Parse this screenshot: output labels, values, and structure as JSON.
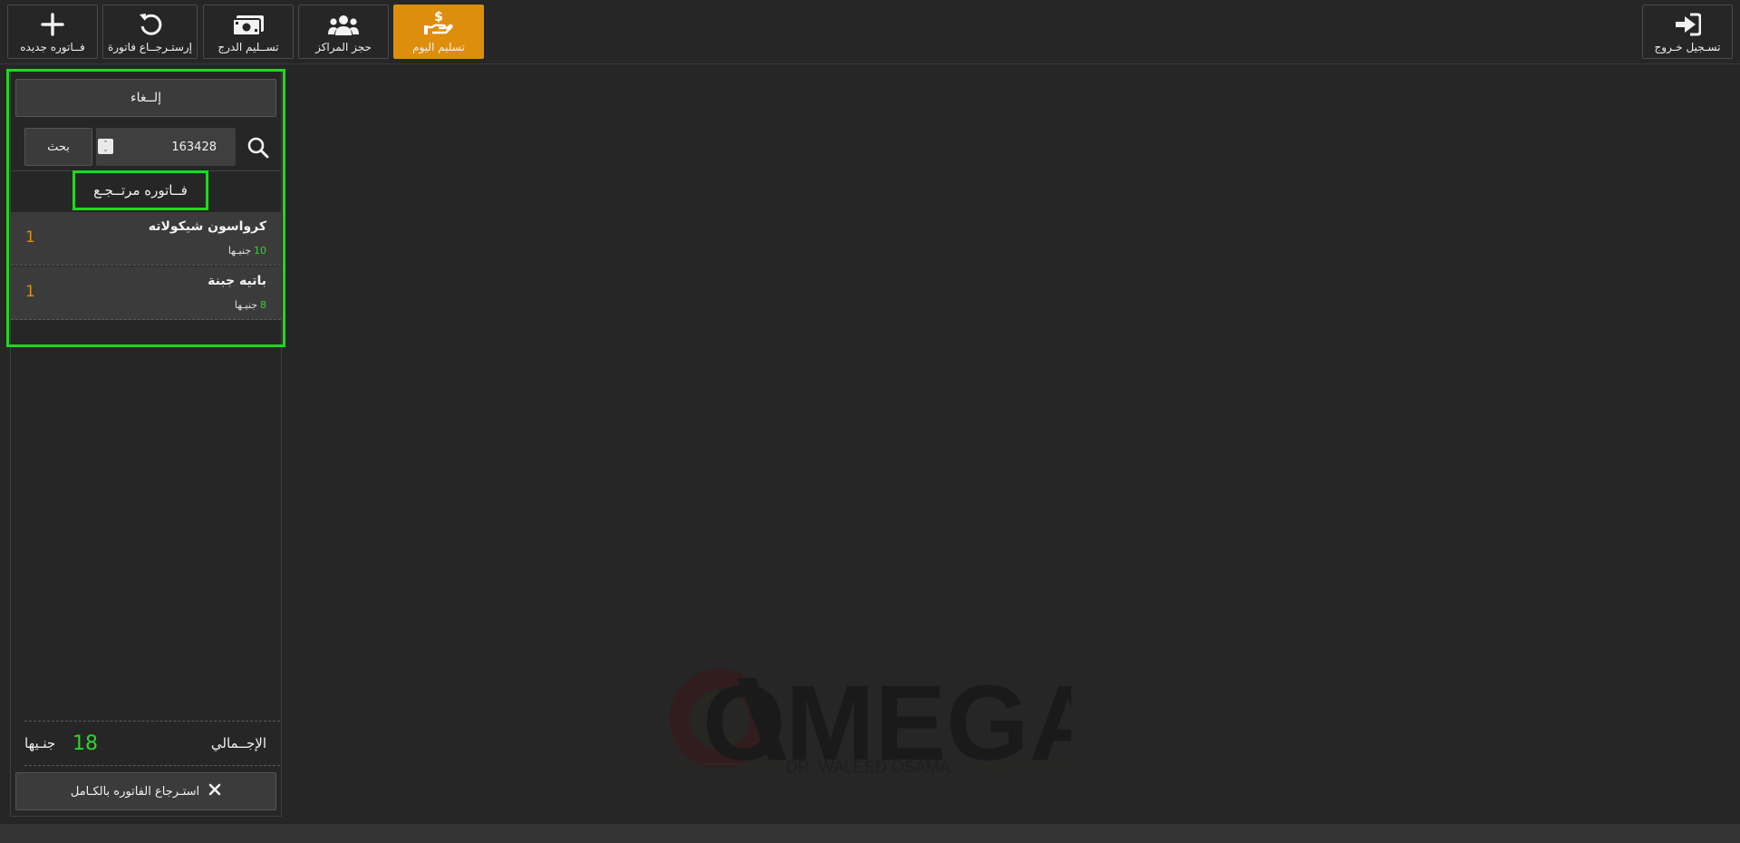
{
  "toolbar": {
    "buttons": [
      {
        "label": "فــاتوره جديده",
        "icon": "plus-icon"
      },
      {
        "label": "إرستـرجــاع فاتورة",
        "icon": "undo-icon"
      },
      {
        "label": "تســليم الدرج",
        "icon": "money-icon"
      },
      {
        "label": "حجز المراكز",
        "icon": "users-icon"
      },
      {
        "label": "تسليم اليوم",
        "icon": "hand-money-icon",
        "active": true
      }
    ],
    "logout": {
      "label": "تسـجيل خـروج",
      "icon": "sign-out-icon"
    }
  },
  "panel": {
    "cancel_label": "إلــغاء",
    "search_value": "163428",
    "search_button": "بحث",
    "invoice_title": "فــاتوره مرتــجـع",
    "items": [
      {
        "name": "كرواسون شيكولاته",
        "price": "10",
        "currency": "جنيـها",
        "qty": "1"
      },
      {
        "name": "باتيه جبنة",
        "price": "8",
        "currency": "جنيـها",
        "qty": "1"
      }
    ],
    "total_label": "الإجــمالي",
    "total_value": "18",
    "total_currency": "جنـيها",
    "refund_all_label": "استـرجاع الفاتوره بالكـامل"
  },
  "watermark": {
    "brand": "OMEGA",
    "subtitle": "DR. WALEED OSAMA"
  },
  "colors": {
    "accent": "#dd8e0c",
    "highlight": "#1fd81f",
    "price": "#2fd42f",
    "background": "#262626"
  }
}
